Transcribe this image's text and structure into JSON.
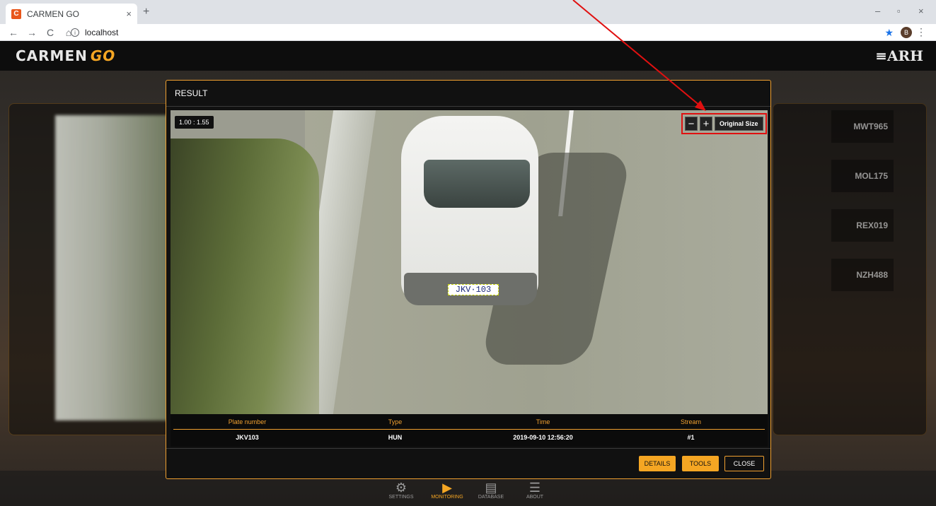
{
  "browser": {
    "tab_title": "CARMEN GO",
    "tab_close": "×",
    "new_tab": "+",
    "url": "localhost",
    "profile_initial": "B",
    "win_min": "–",
    "win_max": "▫",
    "win_close": "×",
    "back": "←",
    "forward": "→",
    "reload": "C",
    "home": "⌂",
    "info": "i",
    "star": "★",
    "menu": "⋮"
  },
  "app": {
    "logo_text": "CARMEN",
    "logo_go": "GO",
    "brand": "≡ARH"
  },
  "background_plates": [
    "MWT965",
    "MOL175",
    "REX019",
    "NZH488"
  ],
  "modal": {
    "title": "RESULT",
    "scale": "1.00 : 1.55",
    "zoom_out": "−",
    "zoom_in": "+",
    "original_size": "Original Size",
    "plate_text": "JKV·103",
    "table": {
      "headers": [
        "Plate number",
        "Type",
        "Time",
        "Stream"
      ],
      "row": [
        "JKV103",
        "HUN",
        "2019-09-10 12:56:20",
        "#1"
      ]
    },
    "buttons": {
      "details": "DETAILS",
      "tools": "TOOLS",
      "close": "CLOSE"
    }
  },
  "bottom_nav": [
    {
      "label": "SETTINGS",
      "icon": "gear-icon",
      "glyph": "⚙"
    },
    {
      "label": "MONITORING",
      "icon": "play-icon",
      "glyph": "▶"
    },
    {
      "label": "DATABASE",
      "icon": "database-icon",
      "glyph": "▤"
    },
    {
      "label": "ABOUT",
      "icon": "chat-icon",
      "glyph": "☰"
    }
  ],
  "colors": {
    "accent": "#f5a623",
    "highlight_box": "#e01010"
  }
}
